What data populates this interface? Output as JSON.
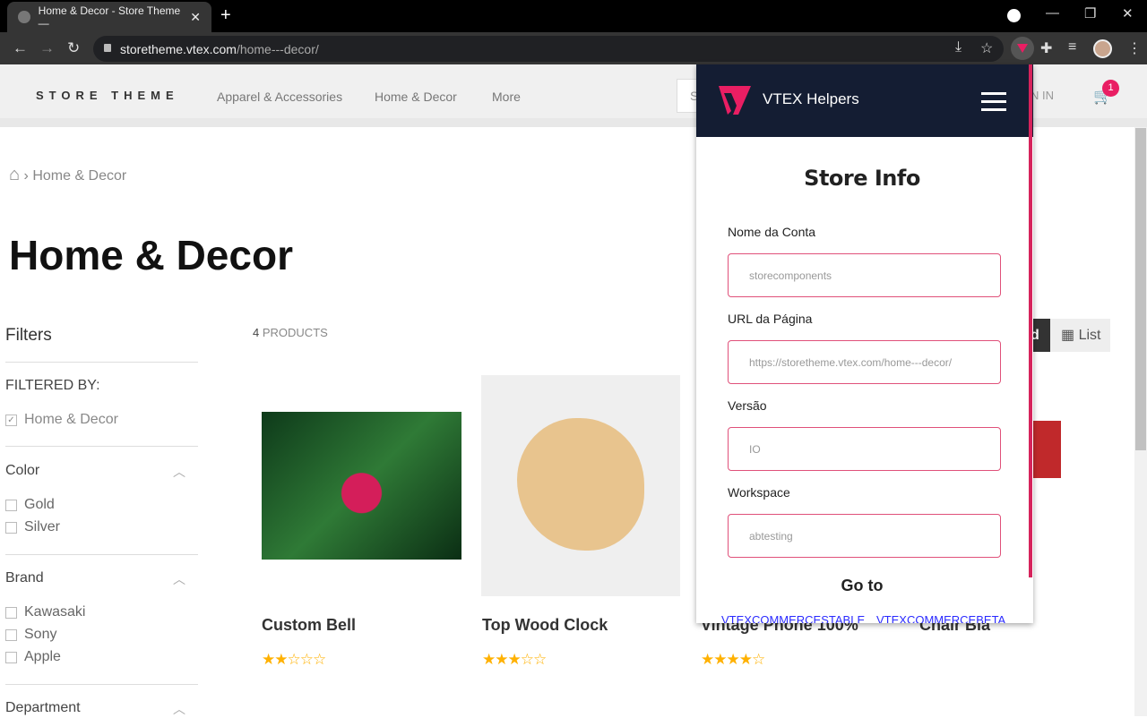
{
  "browser": {
    "tab_title": "Home & Decor - Store Theme —",
    "url_host": "storetheme.vtex.com",
    "url_path": "/home---decor/"
  },
  "store": {
    "logo": "STORE THEME",
    "menu": [
      "Apparel & Accessories",
      "Home & Decor",
      "More"
    ],
    "search_placeholder": "S",
    "signin": "N IN",
    "cart_count": "1"
  },
  "breadcrumb": {
    "current": "Home & Decor"
  },
  "page_title": "Home & Decor",
  "filters": {
    "title": "Filters",
    "filtered_by": "FILTERED BY:",
    "active": "Home & Decor",
    "groups": [
      {
        "name": "Color",
        "options": [
          "Gold",
          "Silver"
        ]
      },
      {
        "name": "Brand",
        "options": [
          "Kawasaki",
          "Sony",
          "Apple"
        ]
      },
      {
        "name": "Department",
        "options": []
      }
    ]
  },
  "results": {
    "count": "4",
    "count_label": "PRODUCTS",
    "grid_label": "d",
    "list_label": "List"
  },
  "products": [
    {
      "name": "Custom Bell",
      "rating": 2
    },
    {
      "name": "Top Wood Clock",
      "rating": 3
    },
    {
      "name": "Vintage Phone 100%",
      "rating": 4
    },
    {
      "name": "Chair Bia",
      "rating": 0
    }
  ],
  "popup": {
    "title": "VTEX Helpers",
    "section": "Store Info",
    "fields": [
      {
        "label": "Nome da Conta",
        "value": "storecomponents"
      },
      {
        "label": "URL da Página",
        "value": "https://storetheme.vtex.com/home---decor/"
      },
      {
        "label": "Versão",
        "value": "IO"
      },
      {
        "label": "Workspace",
        "value": "abtesting"
      }
    ],
    "goto": "Go to",
    "links": [
      "VTEXCOMMERCESTABLE",
      "VTEXCOMMERCEBETA"
    ]
  },
  "colors": {
    "brand": "#e91e63",
    "popup_header": "#141d33",
    "star": "#ffb100"
  }
}
